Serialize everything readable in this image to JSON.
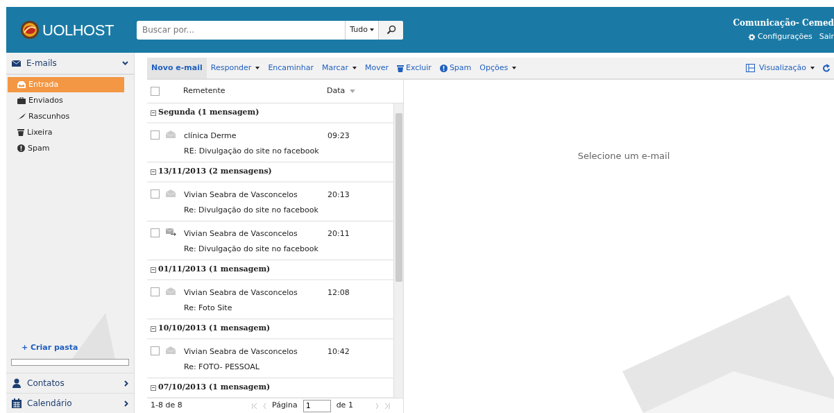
{
  "header": {
    "logo_text": "UOLHOST",
    "search": {
      "placeholder": "Buscar por...",
      "scope": "Tudo"
    },
    "account_name": "Comunicação- Cemed",
    "links": [
      {
        "kind": "settings",
        "label": "Configurações"
      },
      {
        "kind": "plain",
        "label": "Sair"
      }
    ]
  },
  "sidebar": {
    "section": {
      "label": "E-mails",
      "expanded": true
    },
    "folders": [
      {
        "kind": "inbox",
        "label": "Entrada",
        "selected": true
      },
      {
        "kind": "sent",
        "label": "Enviados",
        "selected": false
      },
      {
        "kind": "drafts",
        "label": "Rascunhos",
        "selected": false
      },
      {
        "kind": "trash",
        "label": "Lixeira",
        "selected": false
      },
      {
        "kind": "spam",
        "label": "Spam",
        "selected": false
      }
    ],
    "create_folder": "+ Criar pasta",
    "quota": {
      "level": 0
    },
    "apps": [
      {
        "kind": "contacts",
        "label": "Contatos"
      },
      {
        "kind": "calendar",
        "label": "Calendário"
      }
    ]
  },
  "toolbar": {
    "items": [
      {
        "kind": "primary",
        "label": "Novo e-mail",
        "dropdown": false
      },
      {
        "kind": "plain",
        "label": "Responder",
        "dropdown": true
      },
      {
        "kind": "plain",
        "label": "Encaminhar",
        "dropdown": false
      },
      {
        "kind": "plain",
        "label": "Marcar",
        "dropdown": true
      },
      {
        "kind": "plain",
        "label": "Mover",
        "dropdown": false
      },
      {
        "kind": "trash",
        "label": "Excluir",
        "dropdown": false
      },
      {
        "kind": "spam",
        "label": "Spam",
        "dropdown": false
      },
      {
        "kind": "plain",
        "label": "Opções",
        "dropdown": true
      }
    ],
    "view": {
      "label": "Visualização"
    }
  },
  "message_list": {
    "columns": [
      "Remetente",
      "Data"
    ],
    "select_all_checked": false,
    "groups": [
      {
        "label": "Segunda (1 mensagem)",
        "expanded": true,
        "messages": [
          {
            "kind": "read",
            "checked": false,
            "sender": "clínica Derme",
            "time": "09:23",
            "subject": "RE: Divulgação do site no facebook"
          }
        ]
      },
      {
        "label": "13/11/2013 (2 mensagens)",
        "expanded": true,
        "messages": [
          {
            "kind": "read",
            "checked": false,
            "sender": "Vivian Seabra de Vasconcelos",
            "time": "20:13",
            "subject": "Re: Divulgação do site no facebook"
          },
          {
            "kind": "forwarded",
            "checked": false,
            "sender": "Vivian Seabra de Vasconcelos",
            "time": "20:11",
            "subject": "Re: Divulgação do site no facebook"
          }
        ]
      },
      {
        "label": "01/11/2013 (1 mensagem)",
        "expanded": true,
        "messages": [
          {
            "kind": "read",
            "checked": false,
            "sender": "Vivian Seabra de Vasconcelos",
            "time": "12:08",
            "subject": "Re: Foto Site"
          }
        ]
      },
      {
        "label": "10/10/2013 (1 mensagem)",
        "expanded": true,
        "messages": [
          {
            "kind": "read",
            "checked": false,
            "sender": "Vivian Seabra de Vasconcelos",
            "time": "10:42",
            "subject": "Re: FOTO- PESSOAL"
          }
        ]
      },
      {
        "label": "07/10/2013 (1 mensagem)",
        "expanded": true
      }
    ],
    "pagination": {
      "range": "1-8 de 8",
      "page_label": "Página",
      "page": "1",
      "of": "de 1"
    }
  },
  "reading_pane": {
    "empty_text": "Selecione um e-mail"
  }
}
